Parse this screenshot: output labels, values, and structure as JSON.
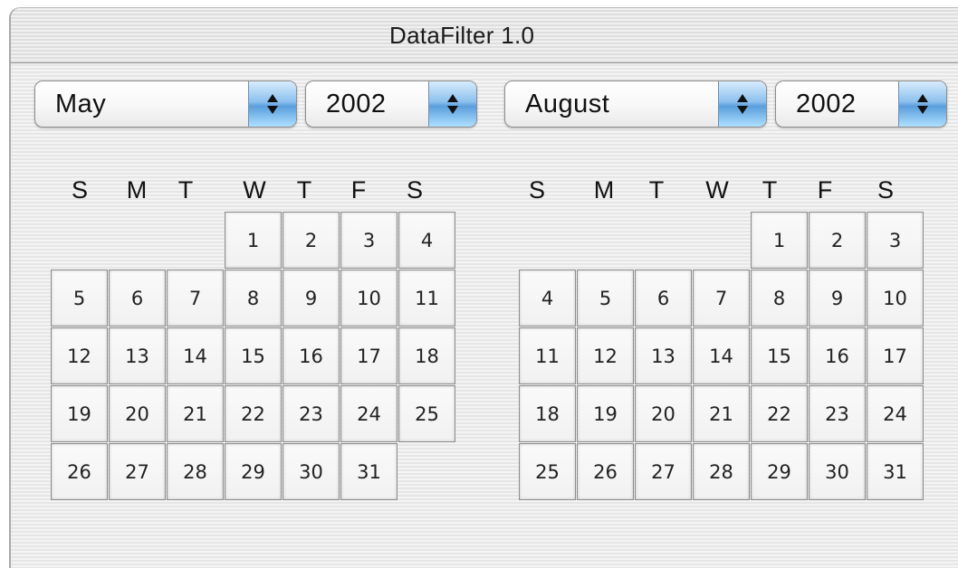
{
  "window": {
    "title": "DataFilter 1.0"
  },
  "left_panel": {
    "month_popup": {
      "value": "May",
      "icon": "updown-arrows-icon"
    },
    "year_popup": {
      "value": "2002",
      "icon": "updown-arrows-icon"
    },
    "weekday_headers": [
      "S",
      "M",
      "T",
      "W",
      "T",
      "F",
      "S"
    ],
    "first_weekday_index": 3,
    "days": [
      "1",
      "2",
      "3",
      "4",
      "5",
      "6",
      "7",
      "8",
      "9",
      "10",
      "11",
      "12",
      "13",
      "14",
      "15",
      "16",
      "17",
      "18",
      "19",
      "20",
      "21",
      "22",
      "23",
      "24",
      "25",
      "26",
      "27",
      "28",
      "29",
      "30",
      "31"
    ]
  },
  "right_panel": {
    "month_popup": {
      "value": "August",
      "icon": "updown-arrows-icon"
    },
    "year_popup": {
      "value": "2002",
      "icon": "updown-arrows-icon"
    },
    "weekday_headers": [
      "S",
      "M",
      "T",
      "W",
      "T",
      "F",
      "S"
    ],
    "first_weekday_index": 4,
    "days": [
      "1",
      "2",
      "3",
      "4",
      "5",
      "6",
      "7",
      "8",
      "9",
      "10",
      "11",
      "12",
      "13",
      "14",
      "15",
      "16",
      "17",
      "18",
      "19",
      "20",
      "21",
      "22",
      "23",
      "24",
      "25",
      "26",
      "27",
      "28",
      "29",
      "30",
      "31"
    ]
  },
  "colors": {
    "popup_arrow_accent": "#5a9edc",
    "cell_border": "#8c8c8c"
  }
}
